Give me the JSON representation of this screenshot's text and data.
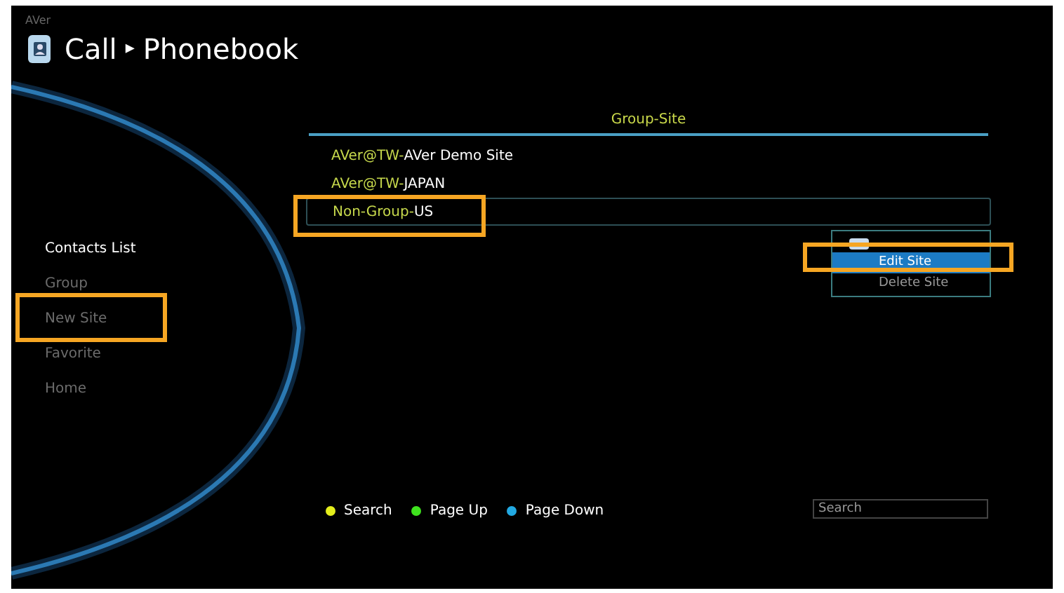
{
  "header": {
    "logo": "AVer",
    "crumbs": [
      "Call",
      "▸",
      "Phonebook"
    ]
  },
  "sidebar": {
    "items": [
      {
        "label": "Contacts List",
        "selected": true
      },
      {
        "label": "Group",
        "selected": false
      },
      {
        "label": "New Site",
        "selected": false
      },
      {
        "label": "Favorite",
        "selected": false
      },
      {
        "label": "Home",
        "selected": false
      }
    ]
  },
  "list": {
    "title": "Group-Site",
    "rows": [
      {
        "group": "AVer@TW-",
        "name": "AVer Demo Site",
        "selected": false
      },
      {
        "group": "AVer@TW-",
        "name": "JAPAN",
        "selected": false
      },
      {
        "group": "Non-Group-",
        "name": "US",
        "selected": true
      }
    ]
  },
  "context_menu": {
    "items": [
      {
        "label": "Edit Site",
        "selected": true
      },
      {
        "label": "Delete Site",
        "selected": false
      }
    ]
  },
  "legend": [
    {
      "label": "Search",
      "color": "#e4ee1c"
    },
    {
      "label": "Page Up",
      "color": "#3fe21e"
    },
    {
      "label": "Page Down",
      "color": "#22a9e2"
    }
  ],
  "search": {
    "placeholder": "Search"
  }
}
